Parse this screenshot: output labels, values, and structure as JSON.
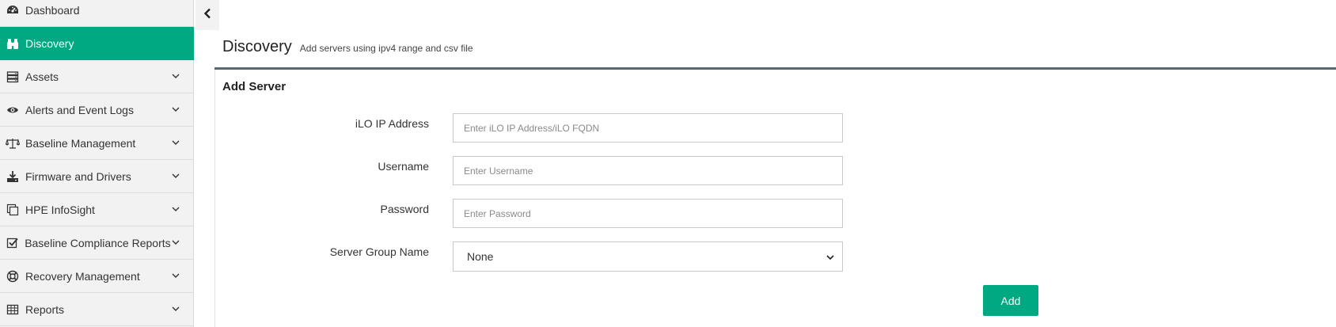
{
  "sidebar": {
    "items": [
      {
        "label": "Dashboard",
        "icon": "dashboard-icon",
        "active": false,
        "has_chevron": false
      },
      {
        "label": "Discovery",
        "icon": "binoculars-icon",
        "active": true,
        "has_chevron": false
      },
      {
        "label": "Assets",
        "icon": "server-stack-icon",
        "active": false,
        "has_chevron": true
      },
      {
        "label": "Alerts and Event Logs",
        "icon": "eye-icon",
        "active": false,
        "has_chevron": true
      },
      {
        "label": "Baseline Management",
        "icon": "scale-icon",
        "active": false,
        "has_chevron": true
      },
      {
        "label": "Firmware and Drivers",
        "icon": "download-icon",
        "active": false,
        "has_chevron": true
      },
      {
        "label": "HPE InfoSight",
        "icon": "copy-icon",
        "active": false,
        "has_chevron": true
      },
      {
        "label": "Baseline Compliance Reports",
        "icon": "checkbox-icon",
        "active": false,
        "has_chevron": true
      },
      {
        "label": "Recovery Management",
        "icon": "lifebuoy-icon",
        "active": false,
        "has_chevron": true
      },
      {
        "label": "Reports",
        "icon": "table-icon",
        "active": false,
        "has_chevron": true
      }
    ]
  },
  "header": {
    "title": "Discovery",
    "subtitle": "Add servers using ipv4 range and csv file"
  },
  "form": {
    "section_title": "Add Server",
    "ilo_ip": {
      "label": "iLO IP Address",
      "placeholder": "Enter iLO IP Address/iLO FQDN",
      "value": ""
    },
    "username": {
      "label": "Username",
      "placeholder": "Enter Username",
      "value": ""
    },
    "password": {
      "label": "Password",
      "placeholder": "Enter Password",
      "value": ""
    },
    "server_group": {
      "label": "Server Group Name",
      "selected": "None"
    },
    "add_label": "Add"
  },
  "colors": {
    "accent": "#01a982",
    "header_rule": "#546a7b",
    "sidebar_bg": "#f2f2f2"
  }
}
